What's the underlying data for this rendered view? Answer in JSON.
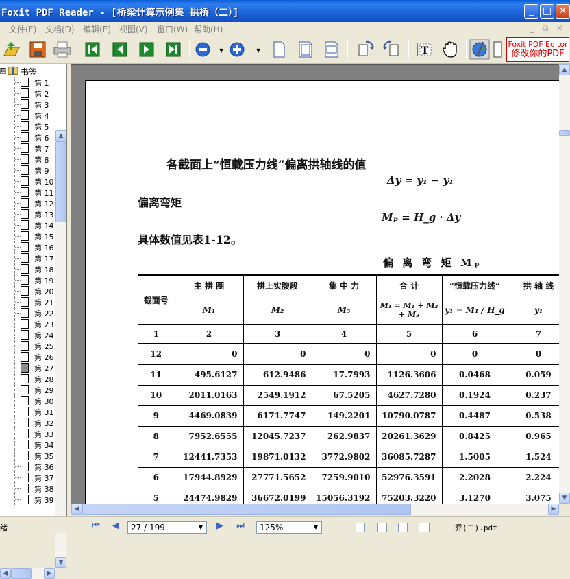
{
  "window": {
    "title": "Foxit PDF Reader - [桥梁计算示例集  拱桥（二）]",
    "min": "_",
    "max": "□",
    "close": "✕"
  },
  "menu": {
    "items": [
      "文件(F)",
      "文档(D)",
      "编辑(E)",
      "视图(V)",
      "窗口(W)",
      "帮助(H)"
    ],
    "mdi_controls": "_ ⧉ ✕"
  },
  "toolbar": {
    "ad_line1": "Foxit PDF Editor",
    "ad_line2": "修改你的PDF"
  },
  "bookmarks": {
    "root_label": "书签",
    "expander": "⊟",
    "items": [
      "第 1",
      "第 2",
      "第 3",
      "第 4",
      "第 5",
      "第 6",
      "第 7",
      "第 8",
      "第 9",
      "第 10",
      "第 11",
      "第 12",
      "第 13",
      "第 14",
      "第 15",
      "第 16",
      "第 17",
      "第 18",
      "第 19",
      "第 20",
      "第 21",
      "第 22",
      "第 23",
      "第 24",
      "第 25",
      "第 26",
      "第 27",
      "第 28",
      "第 29",
      "第 30",
      "第 31",
      "第 32",
      "第 33",
      "第 34",
      "第 35",
      "第 36",
      "第 37",
      "第 38",
      "第 39"
    ],
    "selected_index": 26
  },
  "document": {
    "heading": "各截面上“恒载压力线”偏离拱轴线的值",
    "eq1": "Δy = y₁ − y₁",
    "para1": "偏离弯矩",
    "eq2": "Mₚ = H_g · Δy",
    "para2": "具体数值见表1-12。",
    "table_caption": "偏 离 弯 矩 Mₚ",
    "table": {
      "header1": [
        "截面号",
        "主 拱 圈",
        "拱上实腹段",
        "集 中 力",
        "合      计",
        "“恒载压力线”",
        "拱 轴 线"
      ],
      "header2": [
        "",
        "M₁",
        "M₂",
        "M₃",
        "M₁ = M₁ + M₂ + M₃",
        "y₁ = M₁ / H_g",
        "y₁"
      ],
      "col_numbers": [
        "1",
        "2",
        "3",
        "4",
        "5",
        "6",
        "7"
      ],
      "rows": [
        [
          "12",
          "0",
          "0",
          "0",
          "0",
          "0",
          "0"
        ],
        [
          "11",
          "495.6127",
          "612.9486",
          "17.7993",
          "1126.3606",
          "0.0468",
          "0.059"
        ],
        [
          "10",
          "2011.0163",
          "2549.1912",
          "67.5205",
          "4627.7280",
          "0.1924",
          "0.237"
        ],
        [
          "9",
          "4469.0839",
          "6171.7747",
          "149.2201",
          "10790.0787",
          "0.4487",
          "0.538"
        ],
        [
          "8",
          "7952.6555",
          "12045.7237",
          "262.9837",
          "20261.3629",
          "0.8425",
          "0.965"
        ],
        [
          "7",
          "12441.7353",
          "19871.0132",
          "3772.9802",
          "36085.7287",
          "1.5005",
          "1.524"
        ],
        [
          "6",
          "17944.8929",
          "27771.5652",
          "7259.9010",
          "52976.3591",
          "2.2028",
          "2.224"
        ],
        [
          "5",
          "24474.9829",
          "36672.0199",
          "15056.3192",
          "75203.3220",
          "3.1270",
          "3.075"
        ]
      ]
    }
  },
  "status": {
    "ready": "绪",
    "page_field": "27 / 199",
    "zoom_field": "125%",
    "filename": "乔(二).pdf"
  },
  "colors": {
    "titlebar": "#1a62d6",
    "ad_border": "#cc0000",
    "workspace": "#808080"
  }
}
